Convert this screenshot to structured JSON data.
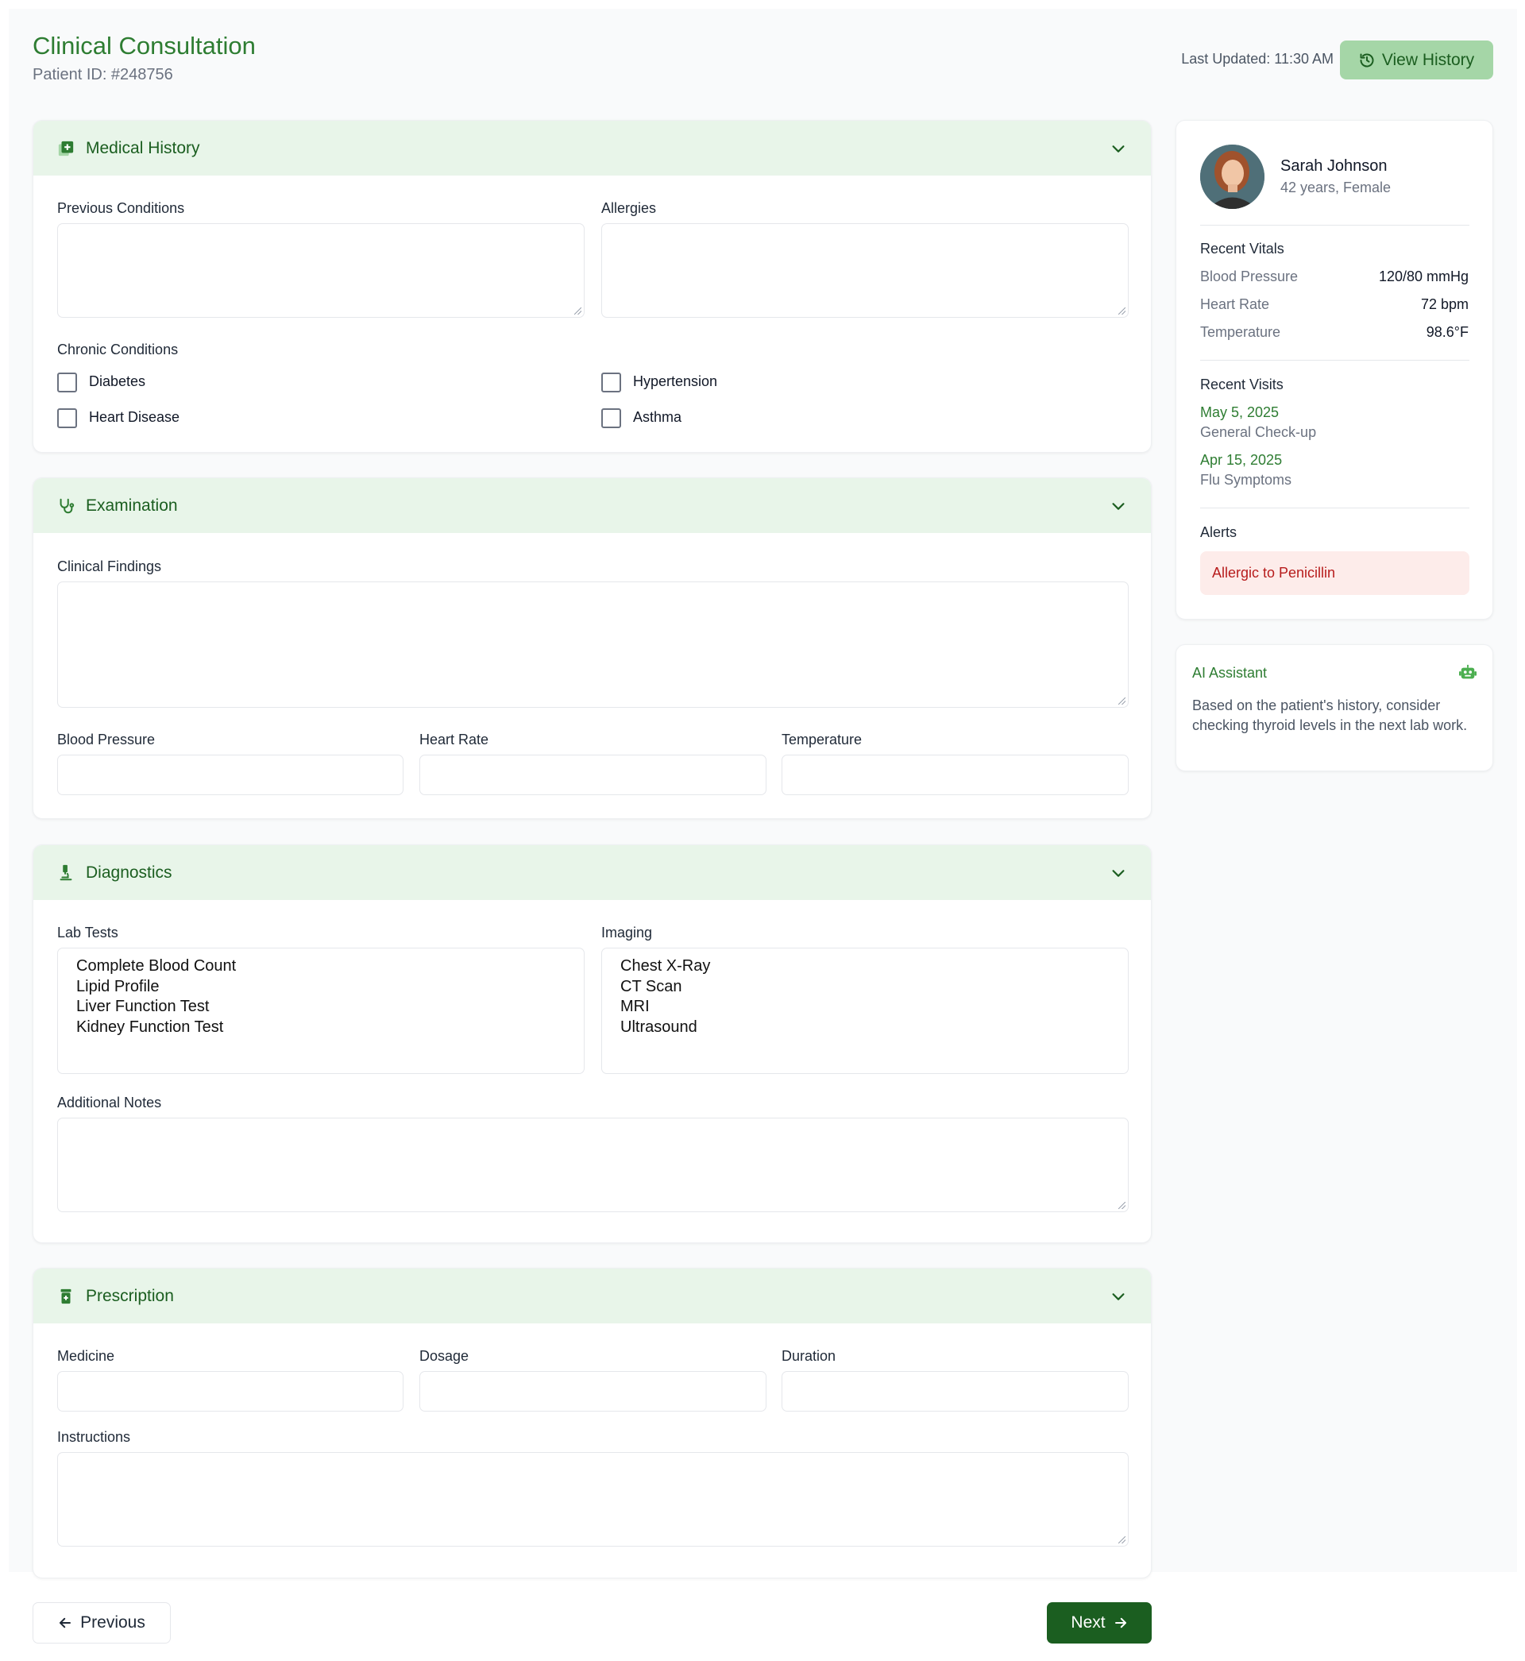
{
  "header": {
    "title": "Clinical Consultation",
    "patient_id": "Patient ID: #248756",
    "last_updated": "Last Updated: 11:30 AM",
    "view_history_label": "View History"
  },
  "sections": {
    "medical_history": {
      "title": "Medical History",
      "previous_conditions_label": "Previous Conditions",
      "allergies_label": "Allergies",
      "chronic_conditions_label": "Chronic Conditions",
      "checkboxes": [
        "Diabetes",
        "Hypertension",
        "Heart Disease",
        "Asthma"
      ]
    },
    "examination": {
      "title": "Examination",
      "clinical_findings_label": "Clinical Findings",
      "blood_pressure_label": "Blood Pressure",
      "heart_rate_label": "Heart Rate",
      "temperature_label": "Temperature"
    },
    "diagnostics": {
      "title": "Diagnostics",
      "lab_tests_label": "Lab Tests",
      "lab_tests_options": [
        "Complete Blood Count",
        "Lipid Profile",
        "Liver Function Test",
        "Kidney Function Test"
      ],
      "imaging_label": "Imaging",
      "imaging_options": [
        "Chest X-Ray",
        "CT Scan",
        "MRI",
        "Ultrasound"
      ],
      "additional_notes_label": "Additional Notes"
    },
    "prescription": {
      "title": "Prescription",
      "medicine_label": "Medicine",
      "dosage_label": "Dosage",
      "duration_label": "Duration",
      "instructions_label": "Instructions"
    }
  },
  "patient": {
    "name": "Sarah Johnson",
    "meta": "42 years, Female",
    "recent_vitals_title": "Recent Vitals",
    "vitals": [
      {
        "label": "Blood Pressure",
        "value": "120/80 mmHg"
      },
      {
        "label": "Heart Rate",
        "value": "72 bpm"
      },
      {
        "label": "Temperature",
        "value": "98.6°F"
      }
    ],
    "recent_visits_title": "Recent Visits",
    "visits": [
      {
        "date": "May 5, 2025",
        "reason": "General Check-up"
      },
      {
        "date": "Apr 15, 2025",
        "reason": "Flu Symptoms"
      }
    ],
    "alerts_title": "Alerts",
    "alert": "Allergic to Penicillin"
  },
  "ai_assistant": {
    "title": "AI Assistant",
    "message": "Based on the patient's history, consider checking thyroid levels in the next lab work."
  },
  "nav": {
    "previous_label": "Previous",
    "next_label": "Next"
  },
  "icons": {
    "history": "history-icon",
    "medical_history": "notes-medical-icon",
    "examination": "stethoscope-icon",
    "diagnostics": "microscope-icon",
    "prescription": "prescription-bottle-icon",
    "chevron": "chevron-down-icon",
    "ai": "robot-icon",
    "previous": "arrow-left-icon",
    "next": "arrow-right-icon"
  },
  "colors": {
    "brand": "#2e7d32",
    "brand_dark": "#1b5e20",
    "section_header_bg": "#e8f5e9",
    "history_button_bg": "#a5d6a7",
    "alert_bg": "#fdecea",
    "alert_text": "#b71c1c"
  }
}
